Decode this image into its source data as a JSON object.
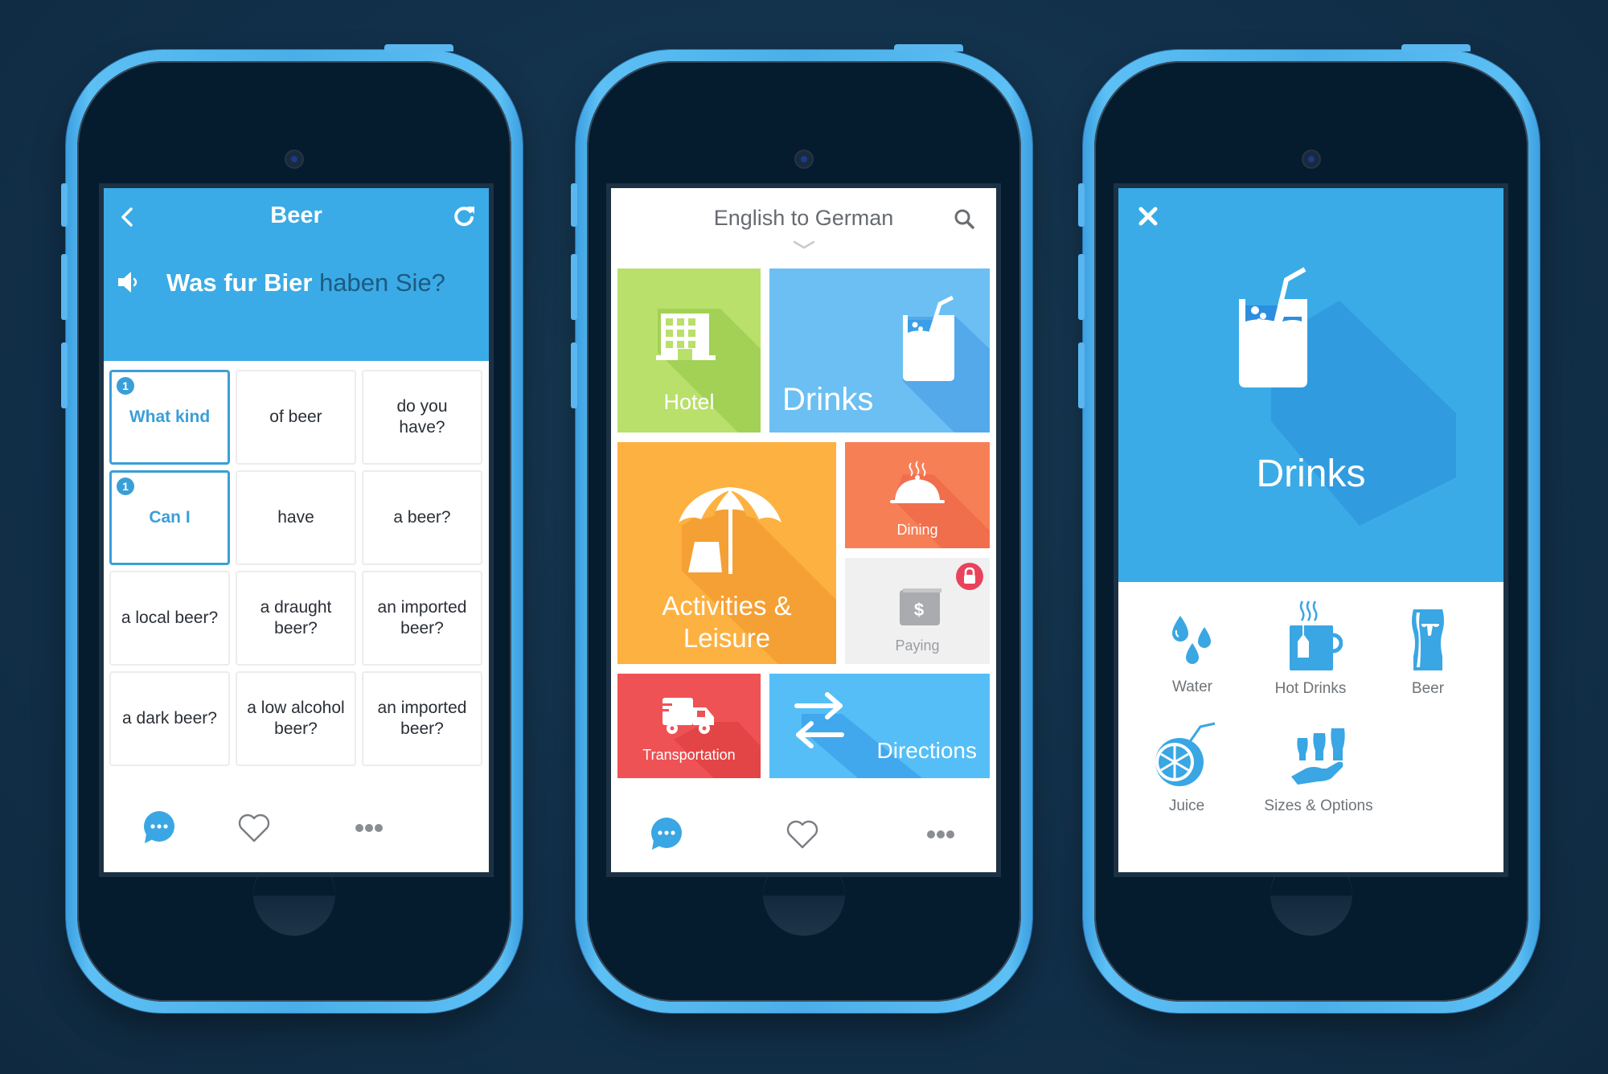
{
  "phones": [
    {
      "screen": "phrase-builder",
      "header": {
        "back_icon": "chevron-left-icon",
        "title": "Beer",
        "refresh_icon": "refresh-icon",
        "speaker_icon": "speaker-icon",
        "phrase_known": "Was fur Bier",
        "phrase_rest": " haben Sie?"
      },
      "grid": [
        {
          "text": "What kind",
          "selected": true,
          "badge": "1"
        },
        {
          "text": "of beer"
        },
        {
          "text": "do you have?"
        },
        {
          "text": "Can I",
          "selected": true,
          "badge": "1"
        },
        {
          "text": "have"
        },
        {
          "text": "a beer?"
        },
        {
          "text": "a local beer?"
        },
        {
          "text": "a draught beer?"
        },
        {
          "text": "an imported beer?"
        },
        {
          "text": "a dark beer?"
        },
        {
          "text": "a low alcohol beer?"
        },
        {
          "text": "an imported beer?"
        }
      ],
      "tabbar": {
        "chat_icon": "chat-bubble-icon",
        "favorite_icon": "heart-icon",
        "more_icon": "more-dots-icon"
      }
    },
    {
      "screen": "categories",
      "header": {
        "title": "English to German",
        "search_icon": "search-icon",
        "dropdown_icon": "chevron-down-icon"
      },
      "tiles": [
        {
          "id": "hotel",
          "label": "Hotel",
          "icon": "building-icon",
          "color": "#b9e06a"
        },
        {
          "id": "drinks",
          "label": "Drinks",
          "icon": "glass-straw-icon",
          "color": "#6cbff2"
        },
        {
          "id": "activities",
          "label": "Activities & Leisure",
          "label_line1": "Activities &",
          "label_line2": "Leisure",
          "icon": "beach-umbrella-icon",
          "color": "#fdb141"
        },
        {
          "id": "dining",
          "label": "Dining",
          "icon": "cloche-icon",
          "color": "#f77f56"
        },
        {
          "id": "paying",
          "label": "Paying",
          "icon": "wallet-dollar-icon",
          "color": "#f0f0f1",
          "locked": true,
          "lock_icon": "lock-icon",
          "lock_color": "#e8435a"
        },
        {
          "id": "transportation",
          "label": "Transportation",
          "icon": "truck-icon",
          "color": "#ef5254"
        },
        {
          "id": "directions",
          "label": "Directions",
          "icon": "swap-arrows-icon",
          "color": "#55bef6"
        }
      ],
      "tabbar": {
        "chat_icon": "chat-bubble-icon",
        "favorite_icon": "heart-icon",
        "more_icon": "more-dots-icon"
      }
    },
    {
      "screen": "category-detail",
      "header": {
        "close_icon": "close-icon",
        "title": "Drinks",
        "hero_icon": "glass-straw-icon"
      },
      "items": [
        {
          "label": "Water",
          "icon": "water-drops-icon"
        },
        {
          "label": "Hot Drinks",
          "icon": "tea-mug-icon"
        },
        {
          "label": "Beer",
          "icon": "beer-glass-icon"
        },
        {
          "label": "Juice",
          "icon": "juice-orange-icon"
        },
        {
          "label": "Sizes & Options",
          "icon": "glasses-hand-icon"
        }
      ]
    }
  ],
  "colors": {
    "background": "#13344a",
    "phone_body": "#4aaee8",
    "accent_blue": "#3aabe6",
    "selected_border": "#3a9fd8",
    "dark_phrase_text": "#1e5a80"
  }
}
